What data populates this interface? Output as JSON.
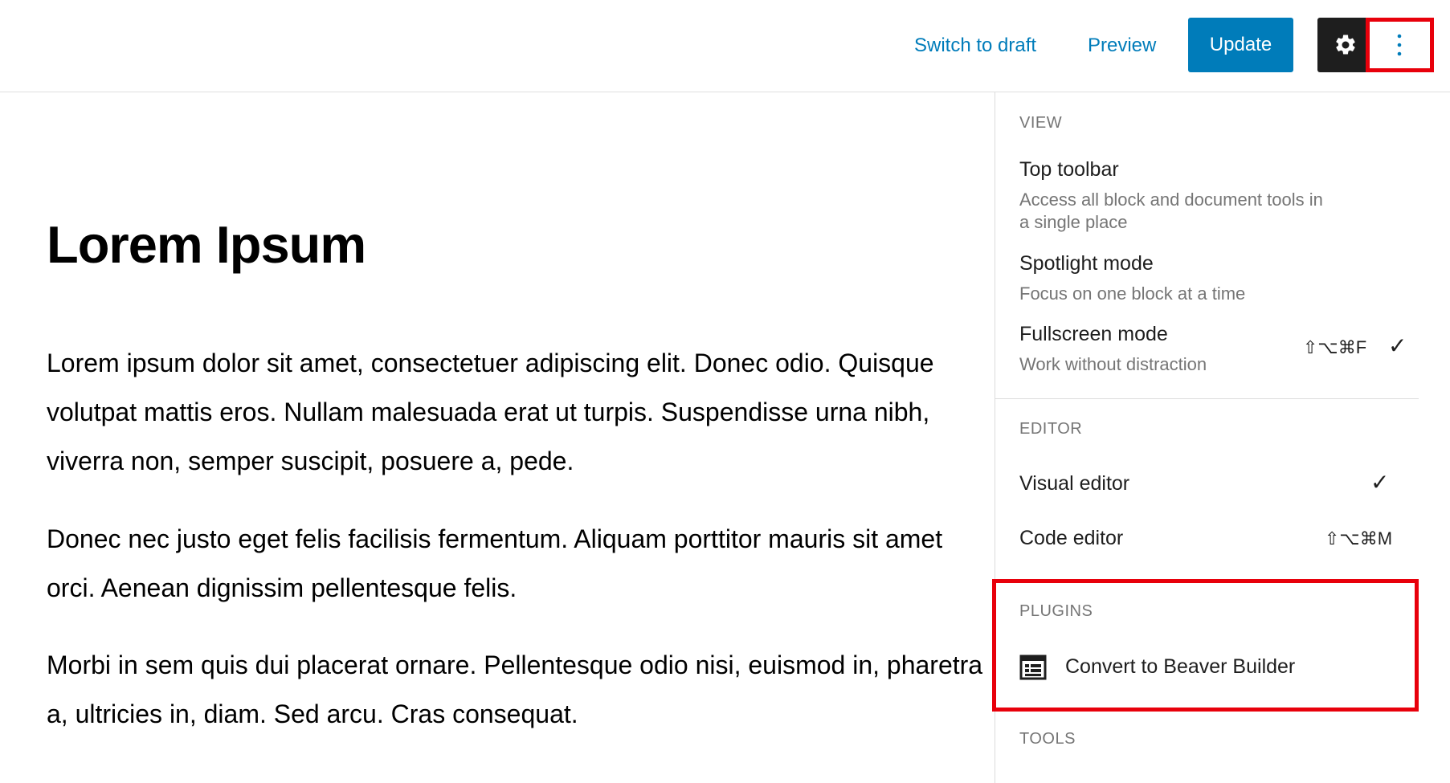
{
  "header": {
    "switch_to_draft": "Switch to draft",
    "preview": "Preview",
    "update": "Update",
    "settings_icon": "gear-icon",
    "more_icon": "vertical-ellipsis-icon"
  },
  "post": {
    "title": "Lorem Ipsum",
    "paragraphs": [
      "Lorem ipsum dolor sit amet, consectetuer adipiscing elit. Donec odio. Quisque volutpat mattis eros. Nullam malesuada erat ut turpis. Suspendisse urna nibh, viverra non, semper suscipit, posuere a, pede.",
      "Donec nec justo eget felis facilisis fermentum. Aliquam porttitor mauris sit amet orci. Aenean dignissim pellentesque felis.",
      "Morbi in sem quis dui placerat ornare. Pellentesque odio nisi, euismod in, pharetra a, ultricies in, diam. Sed arcu. Cras consequat."
    ]
  },
  "menu": {
    "view": {
      "label": "VIEW",
      "top_toolbar": {
        "title": "Top toolbar",
        "desc": "Access all block and document tools in a single place"
      },
      "spotlight": {
        "title": "Spotlight mode",
        "desc": "Focus on one block at a time"
      },
      "fullscreen": {
        "title": "Fullscreen mode",
        "desc": "Work without distraction",
        "shortcut": "⇧⌥⌘F",
        "check": "✓"
      }
    },
    "editor": {
      "label": "EDITOR",
      "visual": {
        "title": "Visual editor",
        "check": "✓"
      },
      "code": {
        "title": "Code editor",
        "shortcut": "⇧⌥⌘M"
      }
    },
    "plugins": {
      "label": "PLUGINS",
      "convert": {
        "title": "Convert to Beaver Builder",
        "icon": "table-layout-icon"
      }
    },
    "tools": {
      "label": "TOOLS"
    }
  },
  "colors": {
    "accent": "#007cba",
    "highlight": "#e8000b",
    "dark": "#1e1e1e",
    "muted": "#757575"
  }
}
